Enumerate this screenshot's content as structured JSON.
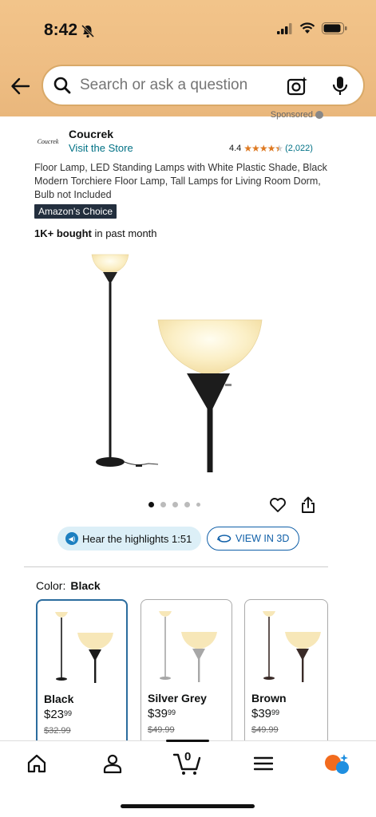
{
  "status_bar": {
    "time": "8:42"
  },
  "search": {
    "placeholder": "Search or ask a question"
  },
  "sponsored_label": "Sponsored",
  "brand": {
    "logo_text": "Coucrek",
    "name": "Coucrek",
    "visit_store": "Visit the Store"
  },
  "rating": {
    "value": "4.4",
    "stars": 4.4,
    "count": "(2,022)"
  },
  "product": {
    "title": "Floor Lamp, LED Standing Lamps with White Plastic Shade, Black Modern Torchiere Floor Lamp, Tall Lamps for Living Room Dorm, Bulb not Included",
    "badge": "Amazon's Choice",
    "bought_bold": "1K+ bought",
    "bought_rest": " in past month",
    "image_count": 5,
    "active_image": 0
  },
  "actions": {
    "highlights": "Hear the highlights 1:51",
    "view3d": "VIEW IN 3D"
  },
  "color": {
    "label": "Color:",
    "selected": "Black"
  },
  "variants": [
    {
      "name": "Black",
      "dollars": "23",
      "cents": "99",
      "old_price": "$32.99",
      "color": "#1a1a1a"
    },
    {
      "name": "Silver Grey",
      "dollars": "39",
      "cents": "99",
      "old_price": "$49.99",
      "color": "#a7a7a7"
    },
    {
      "name": "Brown",
      "dollars": "39",
      "cents": "99",
      "old_price": "$49.99",
      "color": "#3a2b28"
    }
  ],
  "nav": {
    "cart_count": "0"
  },
  "colors": {
    "header": "#eebd83",
    "link": "#007185",
    "star": "#de7921",
    "badge": "#232f3e",
    "accent_blue": "#0f5fa8"
  }
}
